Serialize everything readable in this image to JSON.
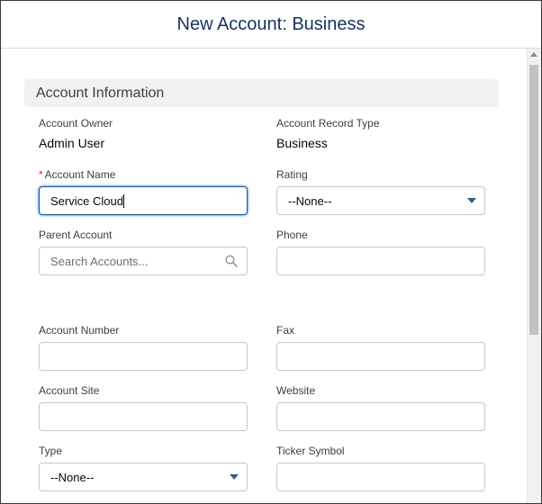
{
  "modal": {
    "title": "New Account: Business"
  },
  "section": {
    "title": "Account Information"
  },
  "fields": {
    "account_owner": {
      "label": "Account Owner",
      "value": "Admin User"
    },
    "record_type": {
      "label": "Account Record Type",
      "value": "Business"
    },
    "account_name": {
      "required_mark": "*",
      "label": "Account Name",
      "value": "Service Cloud"
    },
    "rating": {
      "label": "Rating",
      "value": "--None--"
    },
    "parent_account": {
      "label": "Parent Account",
      "placeholder": "Search Accounts..."
    },
    "phone": {
      "label": "Phone",
      "value": ""
    },
    "account_number": {
      "label": "Account Number",
      "value": ""
    },
    "fax": {
      "label": "Fax",
      "value": ""
    },
    "account_site": {
      "label": "Account Site",
      "value": ""
    },
    "website": {
      "label": "Website",
      "value": ""
    },
    "type": {
      "label": "Type",
      "value": "--None--"
    },
    "ticker_symbol": {
      "label": "Ticker Symbol",
      "value": ""
    }
  },
  "icons": {
    "search": "search-icon",
    "dropdown": "chevron-down-icon"
  },
  "colors": {
    "title": "#16325c",
    "required": "#c23934",
    "focus_border": "#1b5297",
    "section_bg": "#f3f2f2"
  }
}
